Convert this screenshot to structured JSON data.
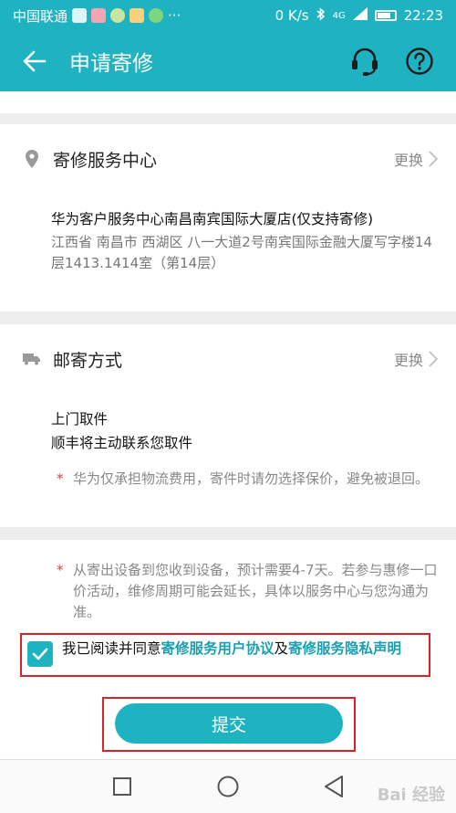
{
  "status_bar": {
    "carrier": "中国联通",
    "speed": "0 K/s",
    "signal": "4G",
    "time": "22:23"
  },
  "app_bar": {
    "title": "申请寄修",
    "icons": [
      "back-arrow-icon",
      "customer-service-headset-icon",
      "help-question-icon"
    ]
  },
  "service_center": {
    "label": "寄修服务中心",
    "change": "更换",
    "name": "华为客户服务中心南昌南宾国际大厦店(仅支持寄修)",
    "address": "江西省 南昌市 西湖区 八一大道2号南宾国际金融大厦写字楼14层1413.1414室（第14层）"
  },
  "shipping": {
    "label": "邮寄方式",
    "change": "更换",
    "method": "上门取件",
    "desc": "顺丰将主动联系您取件",
    "note": "华为仅承担物流费用，寄件时请勿选择保价，避免被退回。"
  },
  "notice": {
    "text": "从寄出设备到您收到设备，预计需要4-7天。若参与惠修一口价活动，维修周期可能会延长，具体以服务中心与您沟通为准。"
  },
  "agreement": {
    "checked": true,
    "prefix": "我已阅读并同意",
    "link1": "寄修服务用户协议",
    "conj": "及",
    "link2": "寄修服务隐私声明"
  },
  "submit_label": "提交",
  "watermark": "Bai 经验",
  "colors": {
    "accent": "#1fb3c2",
    "highlight_frame": "#d6232b",
    "required_star": "#e23b3b"
  }
}
